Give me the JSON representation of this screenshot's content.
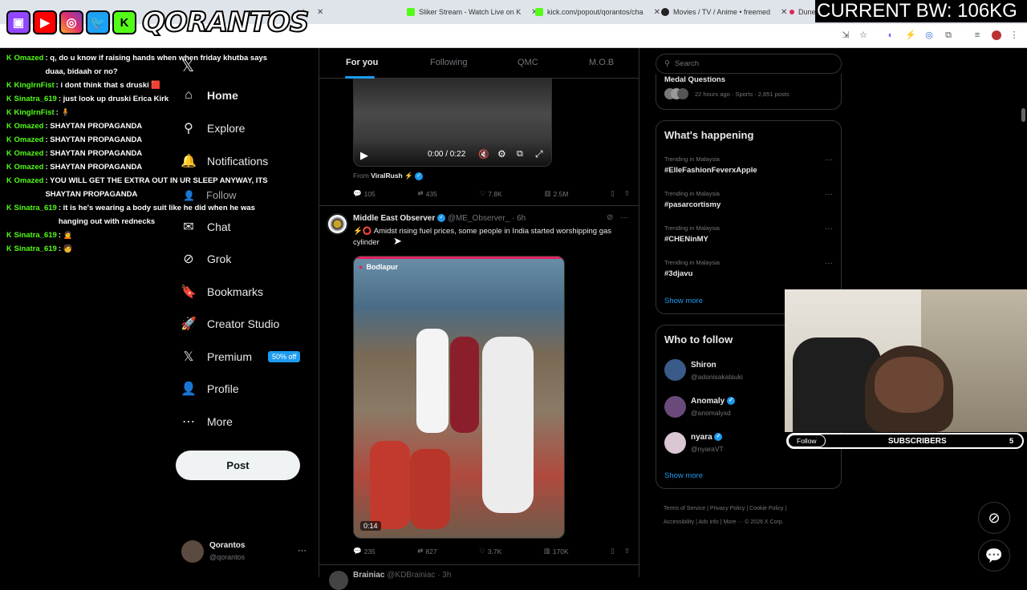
{
  "browser": {
    "tabs": [
      {
        "title": "tch",
        "color": "#999999"
      },
      {
        "title": "Sliker Stream - Watch Live on K",
        "color": "#53fc18"
      },
      {
        "title": "kick.com/popout/qorantos/cha",
        "color": "#53fc18"
      },
      {
        "title": "Movies / TV / Anime • freemed",
        "color": "#222222"
      },
      {
        "title": "Dune",
        "color": "#e0245e"
      }
    ]
  },
  "overlay": {
    "brand": "QORANTOS",
    "bandwidth": "CURRENT BW: 106KG",
    "social_icons": [
      "twitch-icon",
      "youtube-icon",
      "instagram-icon",
      "twitter-icon",
      "kick-icon"
    ]
  },
  "chat": {
    "messages": [
      {
        "user": "Omazed",
        "user_color": "#53fc18",
        "text": ": q, do u know if raising hands when when friday khutba says duaa, bidaah or no?"
      },
      {
        "user": "KingIrnFist",
        "user_color": "#53fc18",
        "text": ": i dont think that s druski 🟥"
      },
      {
        "user": "Sinatra_619",
        "user_color": "#53fc18",
        "text": ": just look up druski Erica Kirk"
      },
      {
        "user": "KingIrnFist",
        "user_color": "#53fc18",
        "text": ": 🧍"
      },
      {
        "user": "Omazed",
        "user_color": "#53fc18",
        "text": ": SHAYTAN PROPAGANDA"
      },
      {
        "user": "Omazed",
        "user_color": "#53fc18",
        "text": ": SHAYTAN PROPAGANDA"
      },
      {
        "user": "Omazed",
        "user_color": "#53fc18",
        "text": ": SHAYTAN PROPAGANDA"
      },
      {
        "user": "Omazed",
        "user_color": "#53fc18",
        "text": ": SHAYTAN PROPAGANDA"
      },
      {
        "user": "Omazed",
        "user_color": "#53fc18",
        "text": ": YOU WILL GET THE EXTRA OUT IN UR SLEEP ANYWAY, ITS SHAYTAN PROPAGANDA"
      },
      {
        "user": "Sinatra_619",
        "user_color": "#53fc18",
        "text": ": it is he's wearing a body suit like he did when he was hanging out with rednecks"
      },
      {
        "user": "Sinatra_619",
        "user_color": "#53fc18",
        "text": ": 🙍"
      },
      {
        "user": "Sinatra_619",
        "user_color": "#53fc18",
        "text": ": 🧑"
      }
    ]
  },
  "nav": {
    "follow_label": "Follow",
    "items": [
      {
        "label": "Home",
        "icon": "home-icon",
        "glyph": "⌂"
      },
      {
        "label": "Explore",
        "icon": "search-icon",
        "glyph": "⚲"
      },
      {
        "label": "Notifications",
        "icon": "bell-icon",
        "glyph": "🔔"
      },
      {
        "label": "Chat",
        "icon": "mail-icon",
        "glyph": "✉"
      },
      {
        "label": "Grok",
        "icon": "grok-icon",
        "glyph": "⊘"
      },
      {
        "label": "Bookmarks",
        "icon": "bookmark-icon",
        "glyph": "🔖"
      },
      {
        "label": "Creator Studio",
        "icon": "rocket-icon",
        "glyph": "🚀"
      },
      {
        "label": "Premium",
        "icon": "x-logo-icon",
        "glyph": "𝕏"
      },
      {
        "label": "Profile",
        "icon": "profile-icon",
        "glyph": "👤"
      },
      {
        "label": "More",
        "icon": "more-circle-icon",
        "glyph": "⋯"
      }
    ],
    "premium_badge": "50% off",
    "post_button": "Post",
    "account": {
      "name": "Qorantos",
      "handle": "@qorantos"
    }
  },
  "timeline": {
    "tabs": [
      "For you",
      "Following",
      "QMC",
      "M.O.B"
    ],
    "tweet1": {
      "video_time": "0:00 / 0:22",
      "from_label": "From",
      "from_name": "ViralRush ⚡",
      "replies": "105",
      "retweets": "435",
      "likes": "7.8K",
      "views": "2.5M"
    },
    "tweet2": {
      "name": "Middle East Observer",
      "handle": "@ME_Observer_",
      "time": "· 6h",
      "text": "⚡⭕ Amidst rising fuel prices, some people in India started worshipping gas cylinder",
      "location": "Bodlapur",
      "duration": "0:14",
      "replies": "235",
      "retweets": "827",
      "likes": "3.7K",
      "views": "170K"
    },
    "tweet3": {
      "name": "Brainiac",
      "handle": "@KDBrainiac",
      "time": "· 3h"
    }
  },
  "right": {
    "search_placeholder": "Search",
    "medal": {
      "title": "Medal Questions",
      "meta": "22 hours ago · Sports · 2,851 posts"
    },
    "whats_happening": "What's happening",
    "trends": [
      {
        "category": "Trending in Malaysia",
        "tag": "#ElleFashionFeverxApple"
      },
      {
        "category": "Trending in Malaysia",
        "tag": "#pasarcortismy"
      },
      {
        "category": "Trending in Malaysia",
        "tag": "#CHENinMY"
      },
      {
        "category": "Trending in Malaysia",
        "tag": "#3djavu"
      }
    ],
    "show_more": "Show more",
    "who_to_follow": "Who to follow",
    "suggestions": [
      {
        "name": "Shiron",
        "handle": "@adonisakatsuki",
        "verified": false
      },
      {
        "name": "Anomaly",
        "handle": "@anomalyxd",
        "verified": true
      },
      {
        "name": "nyara",
        "handle": "@nyaraVT",
        "verified": true
      }
    ],
    "show_more_2": "Show more",
    "footer": [
      "Terms of Service",
      "Privacy Policy",
      "Cookie Policy",
      "Accessibility",
      "Ads info",
      "More ···",
      "© 2026 X Corp."
    ]
  },
  "webcam": {
    "follow": "Follow",
    "subscribers_label": "SUBSCRIBERS",
    "subscribers_count": "5"
  },
  "colors": {
    "accent": "#1d9bf0",
    "kick_green": "#53fc18",
    "bg": "#000000",
    "border": "#2f3336"
  }
}
